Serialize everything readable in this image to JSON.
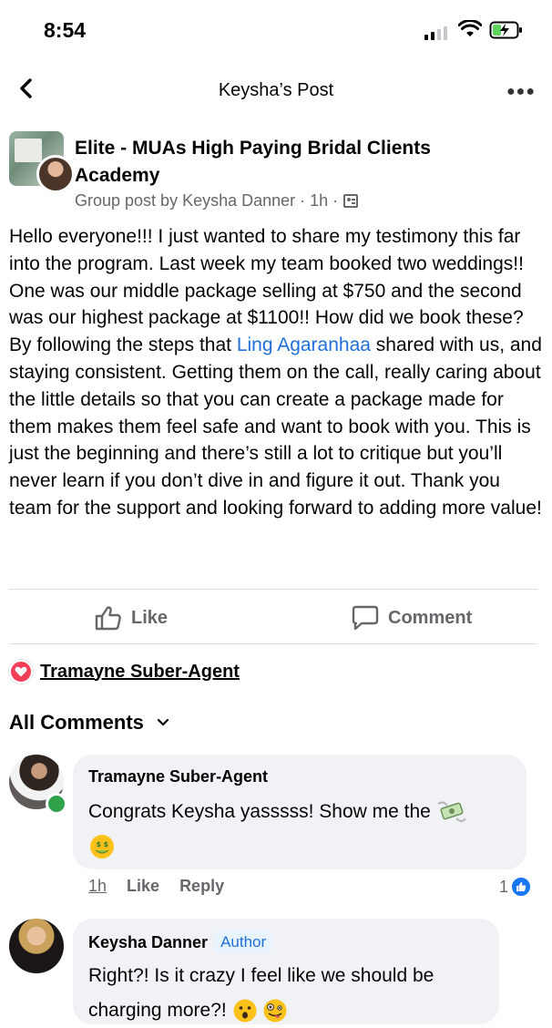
{
  "status_bar": {
    "time": "8:54"
  },
  "nav": {
    "title": "Keysha’s Post"
  },
  "post": {
    "group_name": "Elite - MUAs High Paying Bridal Clients Academy",
    "meta": "Group post by Keysha Danner · 1h ·",
    "body_1": "Hello everyone!!! I just wanted to share my testimony this far into the program. Last week my team booked two weddings!! One was our middle package selling at $750 and the second was our highest package at $1100!! How did we book these? By following the steps that ",
    "mention": "Ling Agaranhaa",
    "body_2": " shared with us, and staying consistent. Getting them on the call, really caring about the little details so that you can create a package made for them makes them feel safe and want to book with you. This is just the beginning and there’s still a lot to critique but you’ll never learn if you don’t dive in and figure it out. Thank you team for the support and looking forward to adding more value!"
  },
  "actions": {
    "like_label": "Like",
    "comment_label": "Comment"
  },
  "reactions": {
    "reactor_name": "Tramayne Suber-Agent",
    "reaction_icon": "heart-icon"
  },
  "comments_header": {
    "label": "All Comments"
  },
  "comments": [
    {
      "author": "Tramayne Suber-Agent",
      "text": "Congrats Keysha yasssss! Show me the",
      "emojis": [
        "money-with-wings",
        "money-mouth-face"
      ],
      "time": "1h",
      "like": "Like",
      "reply": "Reply",
      "reaction_count": "1"
    },
    {
      "author": "Keysha Danner",
      "badge": "Author",
      "text": "Right?! Is it crazy I feel like we should be charging more?!",
      "emojis": [
        "surprised-face",
        "zany-face"
      ]
    }
  ],
  "colors": {
    "link_blue": "#216fdb",
    "secondary_text": "#65676b",
    "bubble_bg": "#f0f2f5",
    "like_blue": "#1877f2",
    "love_red": "#f33e58",
    "online_green": "#31a24c"
  }
}
